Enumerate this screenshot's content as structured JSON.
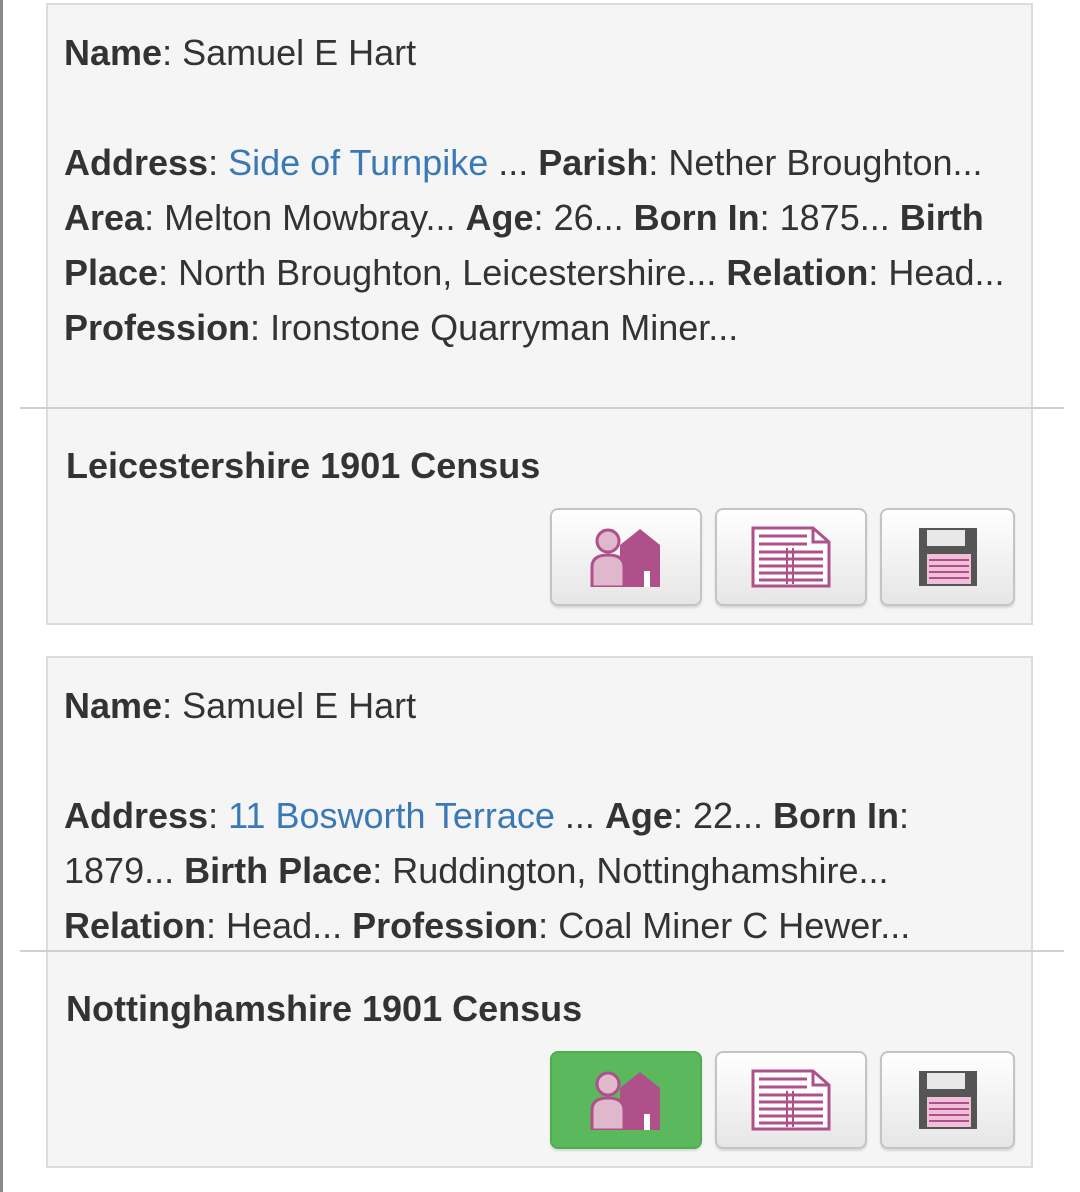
{
  "colors": {
    "link": "#3a79b6",
    "icon_primary": "#b0508a",
    "icon_light": "#e0b8cc",
    "active_button": "#5cb85c"
  },
  "records": [
    {
      "name_label": "Name",
      "name_value": "Samuel E Hart",
      "address_label": "Address",
      "address_value": "Side of Turnpike",
      "fields": [
        {
          "label": "Parish",
          "value": "Nether Broughton..."
        },
        {
          "label": "Area",
          "value": "Melton Mowbray..."
        },
        {
          "label": "Age",
          "value": "26..."
        },
        {
          "label": "Born In",
          "value": "1875..."
        },
        {
          "label": "Birth Place",
          "value": "North Broughton, Leicestershire..."
        },
        {
          "label": "Relation",
          "value": "Head..."
        },
        {
          "label": "Profession",
          "value": "Ironstone Quarryman Miner..."
        }
      ],
      "source": "Leicestershire 1901 Census",
      "buttons": [
        {
          "icon": "family-house-icon",
          "active": false
        },
        {
          "icon": "census-page-icon",
          "active": false
        },
        {
          "icon": "save-disk-icon",
          "active": false
        }
      ]
    },
    {
      "name_label": "Name",
      "name_value": "Samuel E Hart",
      "address_label": "Address",
      "address_value": "11 Bosworth Terrace",
      "fields": [
        {
          "label": "Age",
          "value": "22..."
        },
        {
          "label": "Born In",
          "value": "1879..."
        },
        {
          "label": "Birth Place",
          "value": "Ruddington, Nottinghamshire..."
        },
        {
          "label": "Relation",
          "value": "Head..."
        },
        {
          "label": "Profession",
          "value": "Coal Miner C Hewer..."
        }
      ],
      "source": "Nottinghamshire 1901 Census",
      "buttons": [
        {
          "icon": "family-house-icon",
          "active": true
        },
        {
          "icon": "census-page-icon",
          "active": false
        },
        {
          "icon": "save-disk-icon",
          "active": false
        }
      ]
    }
  ]
}
